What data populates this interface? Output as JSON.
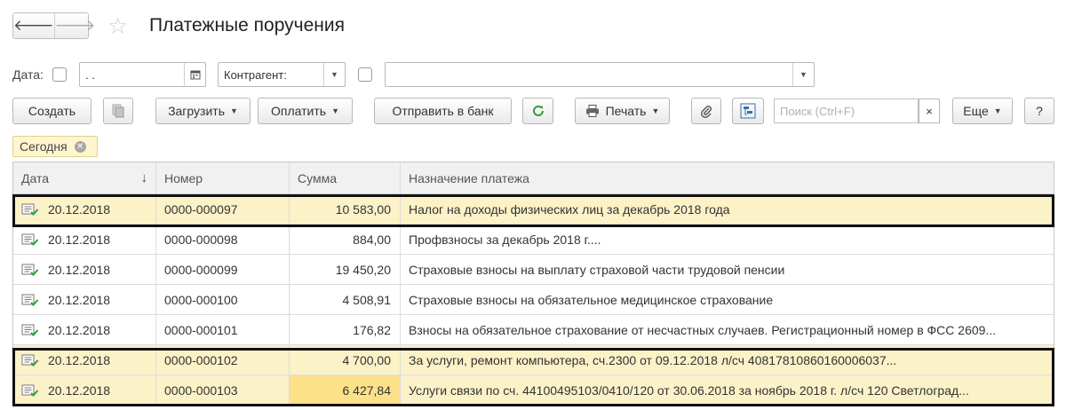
{
  "window": {
    "title": "Платежные поручения",
    "nav": {
      "back": "🡐",
      "forward": "🡒"
    }
  },
  "filters": {
    "date_label": "Дата:",
    "date_value": " .  .",
    "counterparty_label": "Контрагент:",
    "counterparty_value": ""
  },
  "toolbar": {
    "create": "Создать",
    "load": "Загрузить",
    "pay": "Оплатить",
    "send_to_bank": "Отправить в банк",
    "print": "Печать",
    "search_placeholder": "Поиск (Ctrl+F)",
    "more": "Еще",
    "help": "?"
  },
  "active_filter_tag": "Сегодня",
  "table": {
    "columns": [
      "Дата",
      "Номер",
      "Сумма",
      "Назначение платежа"
    ],
    "rows": [
      {
        "date": "20.12.2018",
        "number": "0000-000097",
        "amount": "10 583,00",
        "purpose": "Налог на доходы физических лиц за декабрь 2018 года"
      },
      {
        "date": "20.12.2018",
        "number": "0000-000098",
        "amount": "884,00",
        "purpose": "Профвзносы за  декабрь  2018 г...."
      },
      {
        "date": "20.12.2018",
        "number": "0000-000099",
        "amount": "19 450,20",
        "purpose": "Страховые взносы на выплату страховой части трудовой пенсии"
      },
      {
        "date": "20.12.2018",
        "number": "0000-000100",
        "amount": "4 508,91",
        "purpose": "Страховые взносы на обязательное медицинское страхование"
      },
      {
        "date": "20.12.2018",
        "number": "0000-000101",
        "amount": "176,82",
        "purpose": "Взносы на обязательное страхование от несчастных случаев. Регистрационный номер в ФСС 2609..."
      },
      {
        "date": "20.12.2018",
        "number": "0000-000102",
        "amount": "4 700,00",
        "purpose": "За услуги, ремонт компьютера, сч.2300  от 09.12.2018 л/сч 40817810860160006037..."
      },
      {
        "date": "20.12.2018",
        "number": "0000-000103",
        "amount": "6 427,84",
        "purpose": "Услуги связи по сч. 44100495103/0410/120  от 30.06.2018  за  ноябрь  2018 г.  л/сч 120  Светлоград..."
      }
    ]
  },
  "colors": {
    "selected_row": "#fbf2c8",
    "active_cell": "#fde18a",
    "outline": "#111111",
    "refresh_icon": "#2e9e3e"
  }
}
